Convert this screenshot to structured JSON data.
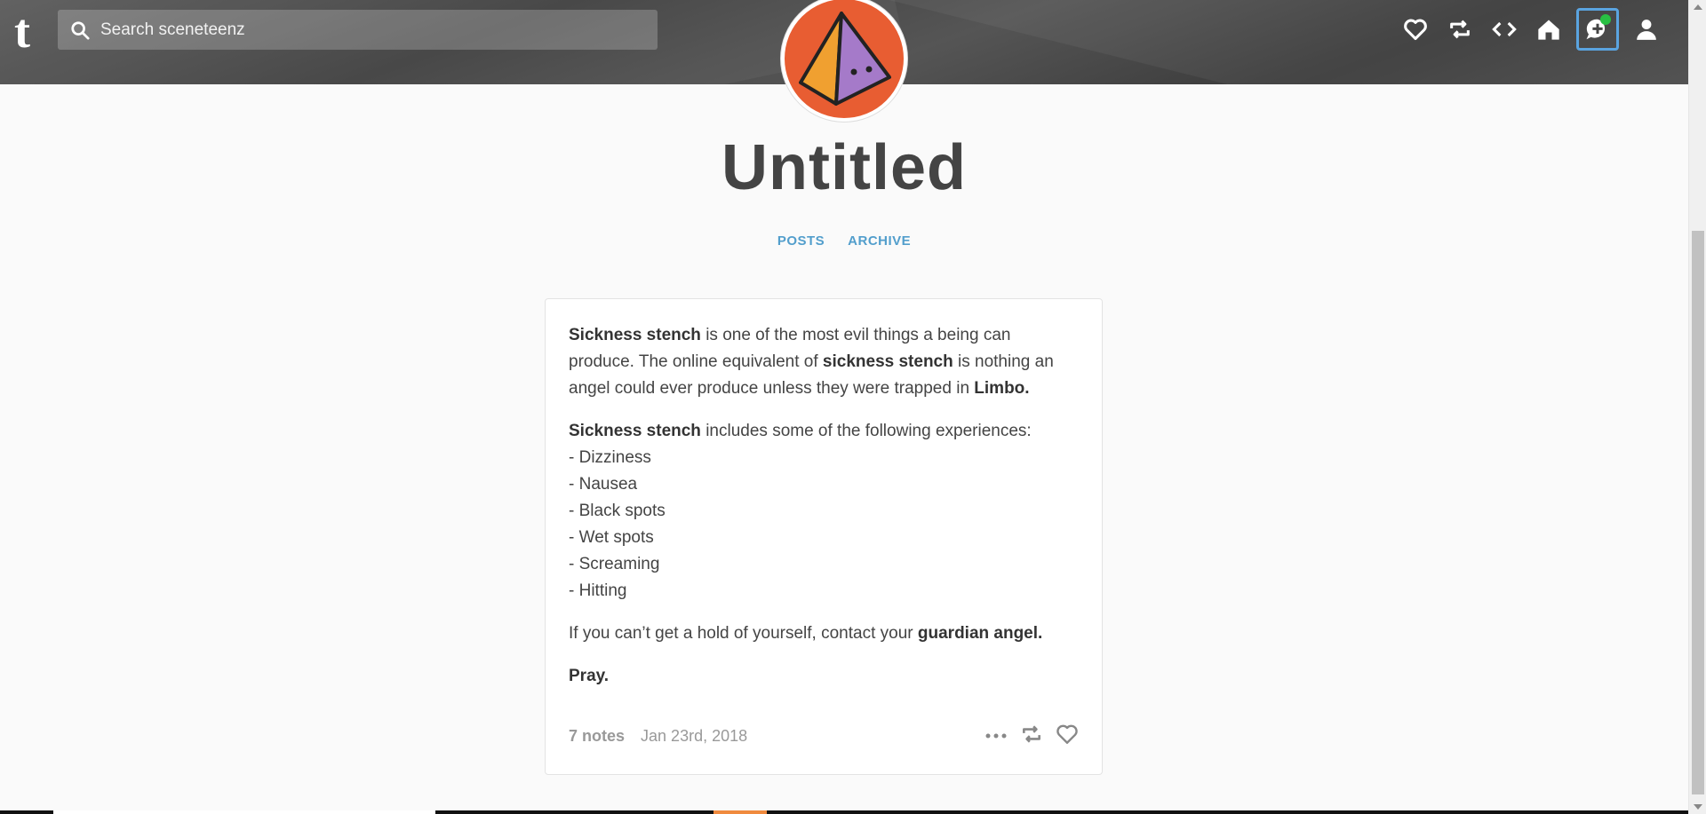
{
  "header": {
    "search_placeholder": "Search sceneteenz"
  },
  "blog": {
    "title": "Untitled",
    "nav": [
      "POSTS",
      "ARCHIVE"
    ]
  },
  "post": {
    "p1": {
      "b1": "Sickness stench",
      "t1": " is one of the most evil things a being can produce. The online equivalent of ",
      "b2": "sickness stench",
      "t2": " is nothing an angel could ever produce unless they were trapped in ",
      "b3": "Limbo."
    },
    "p2": {
      "b1": "Sickness stench",
      "t1": " includes some of the following experiences:"
    },
    "list": [
      "- Dizziness",
      "- Nausea",
      "- Black spots",
      "- Wet spots",
      "- Screaming",
      "- Hitting"
    ],
    "p3": {
      "t1": "If you can’t get a hold of yourself, contact your ",
      "b1": "guardian angel."
    },
    "p4": "Pray.",
    "notes": "7 notes",
    "date": "Jan 23rd, 2018"
  },
  "colors": {
    "accent": "#529ecc",
    "avatar_bg": "#e85d32",
    "notification_dot": "#28c043"
  }
}
